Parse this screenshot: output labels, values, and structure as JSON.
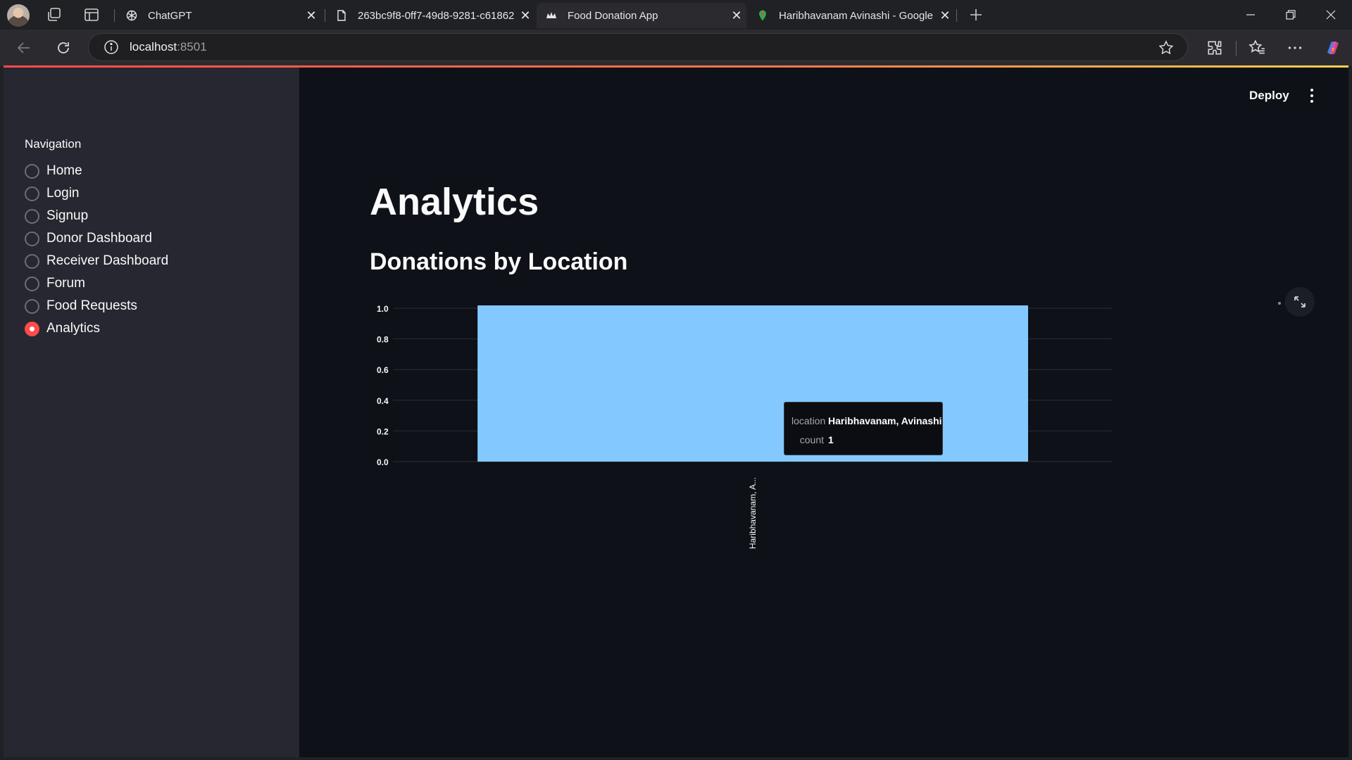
{
  "browser": {
    "tabs": [
      {
        "title": "ChatGPT",
        "active": false
      },
      {
        "title": "263bc9f8-0ff7-49d8-9281-c61862",
        "active": false
      },
      {
        "title": "Food Donation App",
        "active": true
      },
      {
        "title": "Haribhavanam Avinashi - Google",
        "active": false
      }
    ],
    "url_host": "localhost",
    "url_port": ":8501"
  },
  "sidebar": {
    "heading": "Navigation",
    "items": [
      {
        "label": "Home",
        "selected": false
      },
      {
        "label": "Login",
        "selected": false
      },
      {
        "label": "Signup",
        "selected": false
      },
      {
        "label": "Donor Dashboard",
        "selected": false
      },
      {
        "label": "Receiver Dashboard",
        "selected": false
      },
      {
        "label": "Forum",
        "selected": false
      },
      {
        "label": "Food Requests",
        "selected": false
      },
      {
        "label": "Analytics",
        "selected": true
      }
    ],
    "accent_color": "#ff4b4b"
  },
  "header": {
    "deploy_label": "Deploy"
  },
  "main": {
    "title": "Analytics",
    "subheader": "Donations by Location"
  },
  "tooltip": {
    "location_key": "location",
    "location_value": "Haribhavanam, Avinashi",
    "count_key": "count",
    "count_value": "1"
  },
  "chart_data": {
    "type": "bar",
    "categories": [
      "Haribhavanam, Avinashi"
    ],
    "category_tick_labels": [
      "Haribhavanam, A..."
    ],
    "values": [
      1
    ],
    "ylim": [
      0,
      1
    ],
    "yticks": [
      "0.0",
      "0.2",
      "0.4",
      "0.6",
      "0.8",
      "1.0"
    ],
    "bar_color": "#83c9ff",
    "grid": true,
    "title": "",
    "xlabel": "",
    "ylabel": ""
  }
}
